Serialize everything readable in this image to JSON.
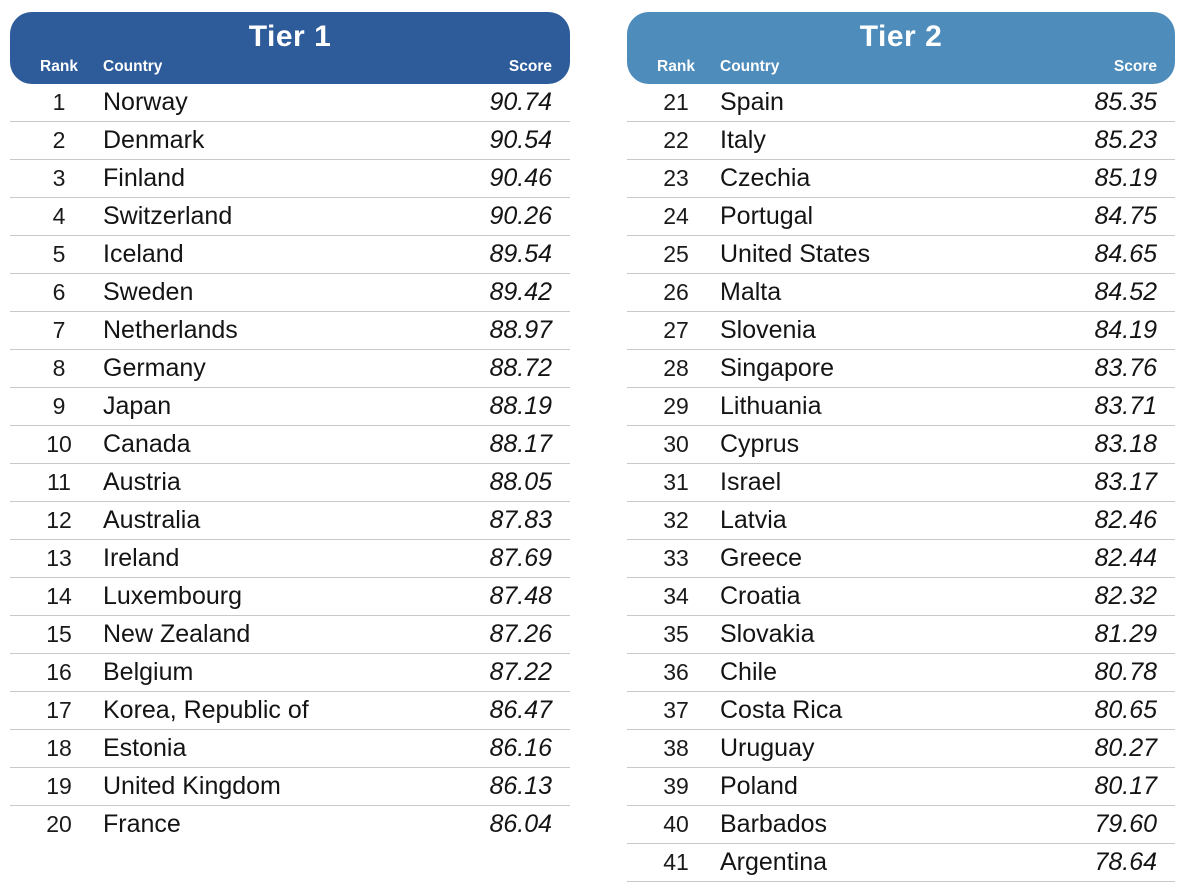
{
  "columns": {
    "rank": "Rank",
    "country": "Country",
    "score": "Score"
  },
  "colors": {
    "tier1_header": "#2e5c9a",
    "tier2_header": "#4d8cbb",
    "header_text": "#ffffff",
    "row_text": "#141414",
    "row_divider": "#c9c9c9",
    "background": "#ffffff"
  },
  "tiers": [
    {
      "id": "tier-1",
      "title": "Tier 1",
      "rows": [
        {
          "rank": "1",
          "country": "Norway",
          "score": "90.74"
        },
        {
          "rank": "2",
          "country": "Denmark",
          "score": "90.54"
        },
        {
          "rank": "3",
          "country": "Finland",
          "score": "90.46"
        },
        {
          "rank": "4",
          "country": "Switzerland",
          "score": "90.26"
        },
        {
          "rank": "5",
          "country": "Iceland",
          "score": "89.54"
        },
        {
          "rank": "6",
          "country": "Sweden",
          "score": "89.42"
        },
        {
          "rank": "7",
          "country": "Netherlands",
          "score": "88.97"
        },
        {
          "rank": "8",
          "country": "Germany",
          "score": "88.72"
        },
        {
          "rank": "9",
          "country": "Japan",
          "score": "88.19"
        },
        {
          "rank": "10",
          "country": "Canada",
          "score": "88.17"
        },
        {
          "rank": "11",
          "country": "Austria",
          "score": "88.05"
        },
        {
          "rank": "12",
          "country": "Australia",
          "score": "87.83"
        },
        {
          "rank": "13",
          "country": "Ireland",
          "score": "87.69"
        },
        {
          "rank": "14",
          "country": "Luxembourg",
          "score": "87.48"
        },
        {
          "rank": "15",
          "country": "New Zealand",
          "score": "87.26"
        },
        {
          "rank": "16",
          "country": "Belgium",
          "score": "87.22"
        },
        {
          "rank": "17",
          "country": "Korea, Republic of",
          "score": "86.47"
        },
        {
          "rank": "18",
          "country": "Estonia",
          "score": "86.16"
        },
        {
          "rank": "19",
          "country": "United Kingdom",
          "score": "86.13"
        },
        {
          "rank": "20",
          "country": "France",
          "score": "86.04"
        }
      ]
    },
    {
      "id": "tier-2",
      "title": "Tier 2",
      "rows": [
        {
          "rank": "21",
          "country": "Spain",
          "score": "85.35"
        },
        {
          "rank": "22",
          "country": "Italy",
          "score": "85.23"
        },
        {
          "rank": "23",
          "country": "Czechia",
          "score": "85.19"
        },
        {
          "rank": "24",
          "country": "Portugal",
          "score": "84.75"
        },
        {
          "rank": "25",
          "country": "United States",
          "score": "84.65"
        },
        {
          "rank": "26",
          "country": "Malta",
          "score": "84.52"
        },
        {
          "rank": "27",
          "country": "Slovenia",
          "score": "84.19"
        },
        {
          "rank": "28",
          "country": "Singapore",
          "score": "83.76"
        },
        {
          "rank": "29",
          "country": "Lithuania",
          "score": "83.71"
        },
        {
          "rank": "30",
          "country": "Cyprus",
          "score": "83.18"
        },
        {
          "rank": "31",
          "country": "Israel",
          "score": "83.17"
        },
        {
          "rank": "32",
          "country": "Latvia",
          "score": "82.46"
        },
        {
          "rank": "33",
          "country": "Greece",
          "score": "82.44"
        },
        {
          "rank": "34",
          "country": "Croatia",
          "score": "82.32"
        },
        {
          "rank": "35",
          "country": "Slovakia",
          "score": "81.29"
        },
        {
          "rank": "36",
          "country": "Chile",
          "score": "80.78"
        },
        {
          "rank": "37",
          "country": "Costa Rica",
          "score": "80.65"
        },
        {
          "rank": "38",
          "country": "Uruguay",
          "score": "80.27"
        },
        {
          "rank": "39",
          "country": "Poland",
          "score": "80.17"
        },
        {
          "rank": "40",
          "country": "Barbados",
          "score": "79.60"
        },
        {
          "rank": "41",
          "country": "Argentina",
          "score": "78.64"
        }
      ]
    }
  ]
}
